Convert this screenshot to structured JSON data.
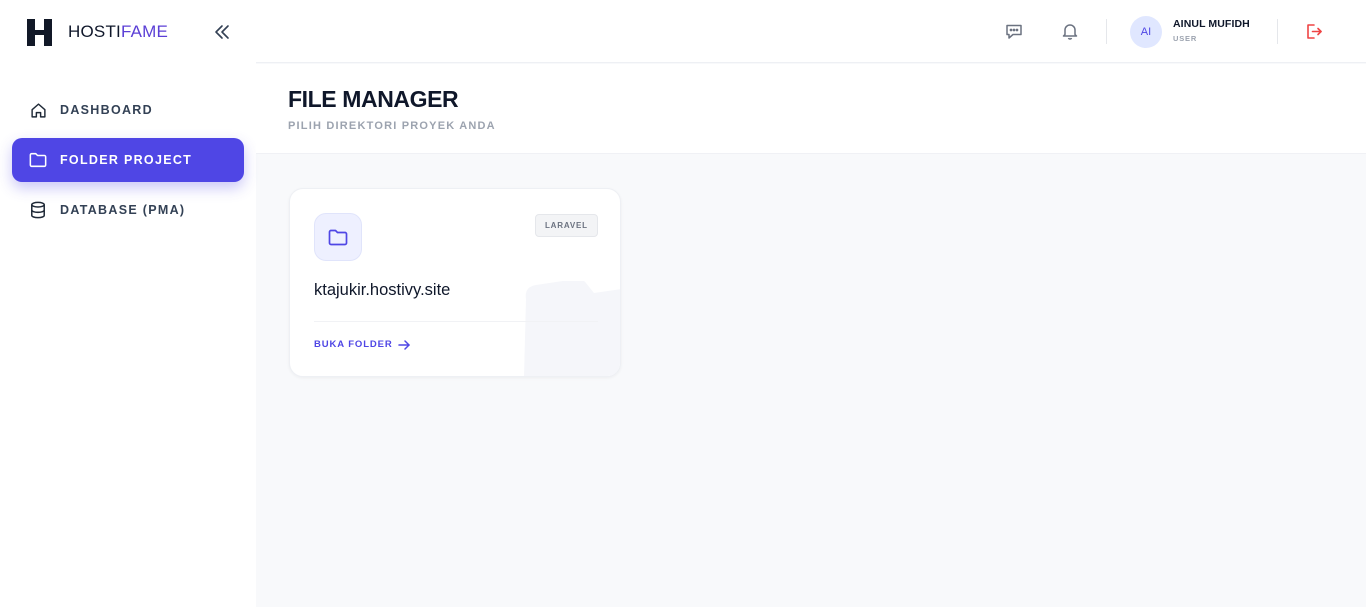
{
  "brand": {
    "name_primary": "HOSTI",
    "name_accent": "FAME",
    "accent_color": "#5b3fd6"
  },
  "sidebar": {
    "collapse_icon": "chevrons-left-icon",
    "items": [
      {
        "label": "DASHBOARD",
        "icon": "home-icon",
        "active": false
      },
      {
        "label": "FOLDER PROJECT",
        "icon": "folder-icon",
        "active": true
      },
      {
        "label": "DATABASE (PMA)",
        "icon": "database-icon",
        "active": false
      }
    ],
    "active_color": "#4f46e5"
  },
  "header": {
    "icons": [
      "chat-icon",
      "bell-icon",
      "logout-icon"
    ],
    "user": {
      "initials": "AI",
      "name": "AINUL MUFIDH",
      "role": "USER"
    },
    "logout_color": "#ef4444"
  },
  "page": {
    "title": "FILE MANAGER",
    "subtitle": "PILIH DIREKTORI PROYEK ANDA"
  },
  "projects": [
    {
      "name": "ktajukir.hostivy.site",
      "tag": "LARAVEL",
      "action_label": "BUKA FOLDER",
      "icon": "folder-icon"
    }
  ]
}
